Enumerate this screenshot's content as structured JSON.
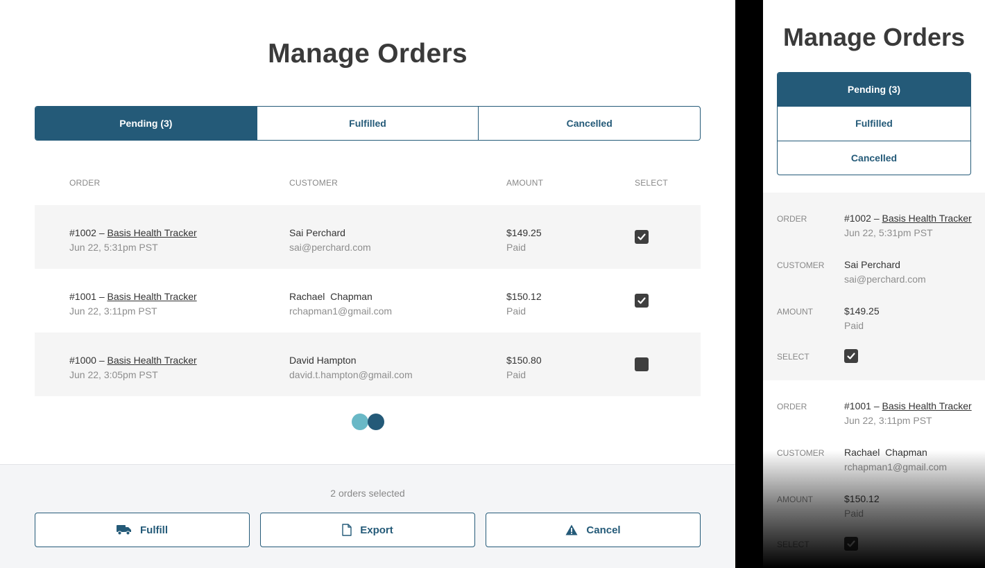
{
  "page": {
    "title": "Manage Orders"
  },
  "tabs": [
    {
      "label": "Pending (3)",
      "active": true
    },
    {
      "label": "Fulfilled",
      "active": false
    },
    {
      "label": "Cancelled",
      "active": false
    }
  ],
  "table": {
    "headers": {
      "order": "ORDER",
      "customer": "CUSTOMER",
      "amount": "AMOUNT",
      "select": "SELECT"
    },
    "rows": [
      {
        "order_number": "#1002 –",
        "product": "Basis Health Tracker",
        "date": "Jun 22, 5:31pm PST",
        "customer_name": "Sai Perchard",
        "customer_email": "sai@perchard.com",
        "amount": "$149.25",
        "status": "Paid",
        "selected": true
      },
      {
        "order_number": "#1001 –",
        "product": "Basis Health Tracker",
        "date": "Jun 22, 3:11pm PST",
        "customer_name": "Rachael  Chapman",
        "customer_email": "rchapman1@gmail.com",
        "amount": "$150.12",
        "status": "Paid",
        "selected": true
      },
      {
        "order_number": "#1000 –",
        "product": "Basis Health Tracker",
        "date": "Jun 22, 3:05pm PST",
        "customer_name": "David Hampton",
        "customer_email": "david.t.hampton@gmail.com",
        "amount": "$150.80",
        "status": "Paid",
        "selected": false
      }
    ]
  },
  "footer": {
    "selection_text": "2 orders selected",
    "buttons": {
      "fulfill": {
        "label": "Fulfill",
        "icon": "truck-icon"
      },
      "export": {
        "label": "Export",
        "icon": "document-icon"
      },
      "cancel": {
        "label": "Cancel",
        "icon": "warning-icon"
      }
    }
  },
  "colors": {
    "primary": "#245a78",
    "accent": "#69b8c6",
    "row_shade": "#f5f5f5",
    "footer_bg": "#f4f5f7",
    "checkbox": "#3f3f3f"
  }
}
